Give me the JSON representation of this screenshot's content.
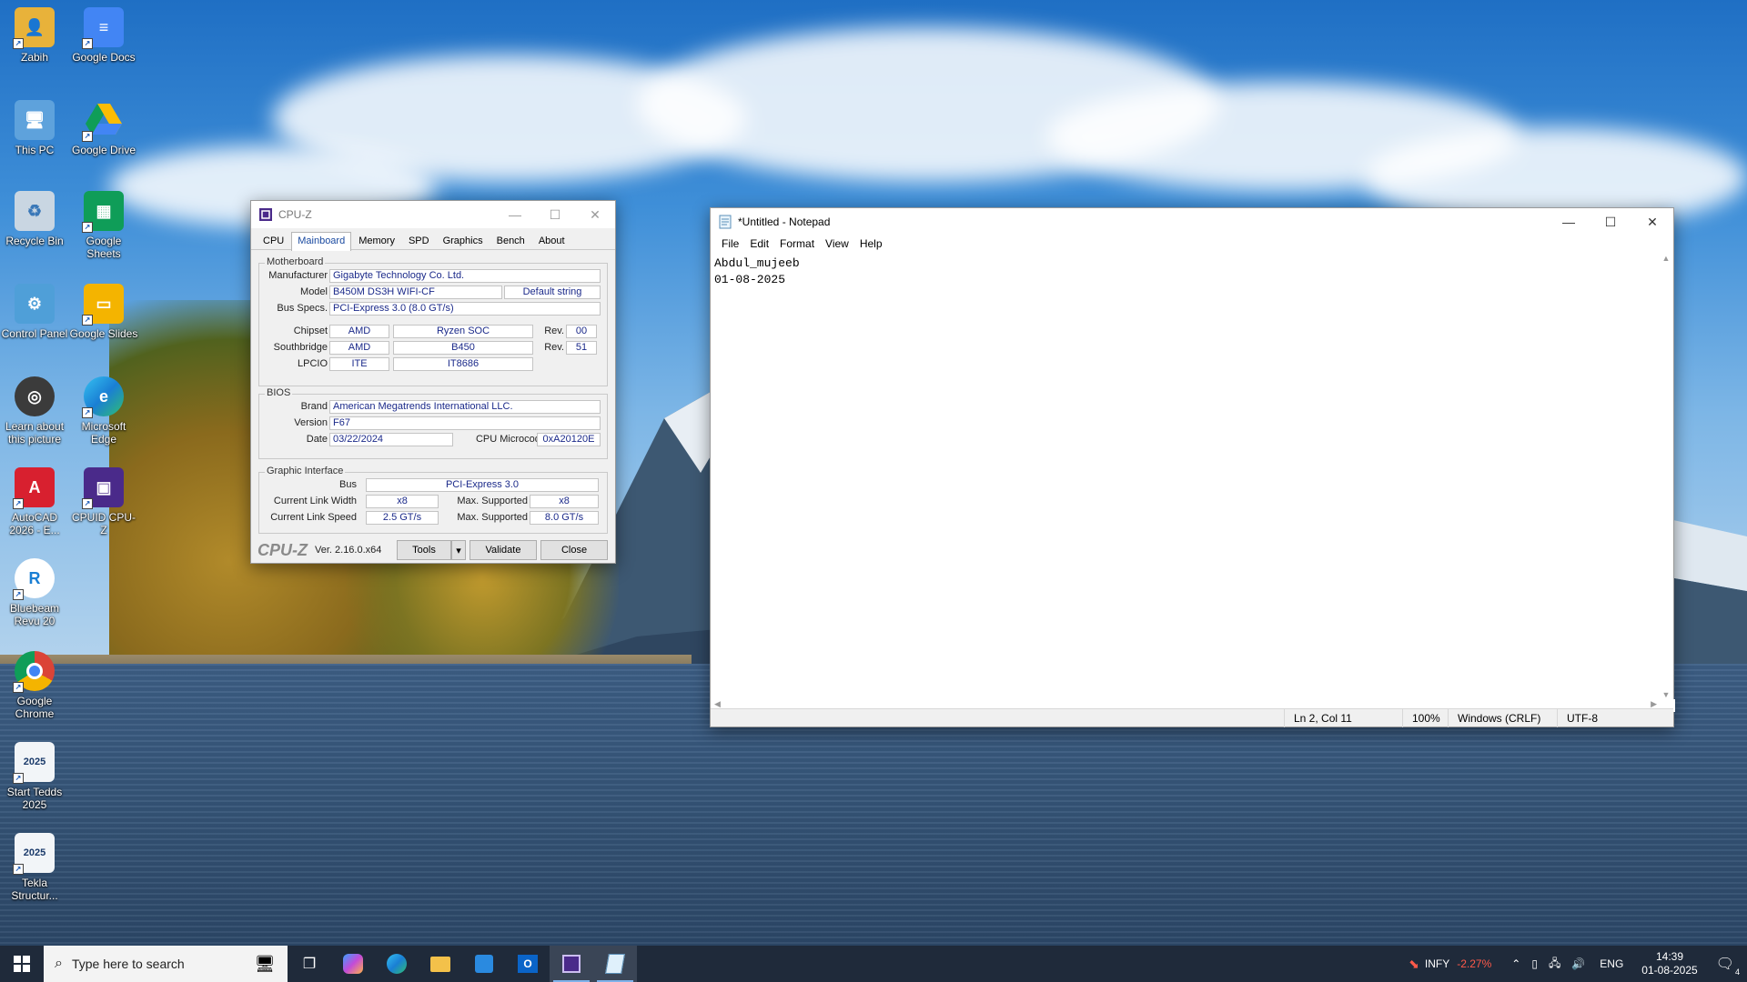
{
  "desktop": {
    "icons": [
      {
        "label": "Zabih",
        "icon": "user-folder-icon"
      },
      {
        "label": "Google Docs",
        "icon": "google-docs-icon"
      },
      {
        "label": "This PC",
        "icon": "this-pc-icon"
      },
      {
        "label": "Google Drive",
        "icon": "google-drive-icon"
      },
      {
        "label": "Recycle Bin",
        "icon": "recycle-bin-icon"
      },
      {
        "label": "Google Sheets",
        "icon": "google-sheets-icon"
      },
      {
        "label": "Control Panel",
        "icon": "control-panel-icon"
      },
      {
        "label": "Google Slides",
        "icon": "google-slides-icon"
      },
      {
        "label": "Learn about this picture",
        "icon": "learn-picture-icon"
      },
      {
        "label": "Microsoft Edge",
        "icon": "edge-icon"
      },
      {
        "label": "AutoCAD 2026 - E...",
        "icon": "autocad-icon"
      },
      {
        "label": "CPUID CPU-Z",
        "icon": "cpuz-icon"
      },
      {
        "label": "Bluebeam Revu 20",
        "icon": "bluebeam-icon"
      },
      {
        "label": "Google Chrome",
        "icon": "chrome-icon"
      },
      {
        "label": "Start Tedds 2025",
        "icon": "tedds-icon"
      },
      {
        "label": "Tekla Structur...",
        "icon": "tekla-icon"
      }
    ]
  },
  "cpuz": {
    "title": "CPU-Z",
    "tabs": [
      "CPU",
      "Mainboard",
      "Memory",
      "SPD",
      "Graphics",
      "Bench",
      "About"
    ],
    "active_tab": "Mainboard",
    "motherboard": {
      "group_title": "Motherboard",
      "manufacturer_label": "Manufacturer",
      "manufacturer": "Gigabyte Technology Co. Ltd.",
      "model_label": "Model",
      "model": "B450M DS3H WIFI-CF",
      "model_extra": "Default string",
      "bus_specs_label": "Bus Specs.",
      "bus_specs": "PCI-Express 3.0 (8.0 GT/s)",
      "chipset_label": "Chipset",
      "chipset_vendor": "AMD",
      "chipset_name": "Ryzen SOC",
      "chipset_rev_label": "Rev.",
      "chipset_rev": "00",
      "southbridge_label": "Southbridge",
      "southbridge_vendor": "AMD",
      "southbridge_name": "B450",
      "southbridge_rev_label": "Rev.",
      "southbridge_rev": "51",
      "lpcio_label": "LPCIO",
      "lpcio_vendor": "ITE",
      "lpcio_name": "IT8686"
    },
    "bios": {
      "group_title": "BIOS",
      "brand_label": "Brand",
      "brand": "American Megatrends International LLC.",
      "version_label": "Version",
      "version": "F67",
      "date_label": "Date",
      "date": "03/22/2024",
      "microcode_label": "CPU Microcode",
      "microcode": "0xA20120E"
    },
    "graphic": {
      "group_title": "Graphic Interface",
      "bus_label": "Bus",
      "bus": "PCI-Express 3.0",
      "link_width_label": "Current Link Width",
      "link_width": "x8",
      "max_width_label": "Max. Supported",
      "max_width": "x8",
      "link_speed_label": "Current Link Speed",
      "link_speed": "2.5 GT/s",
      "max_speed_label": "Max. Supported",
      "max_speed": "8.0 GT/s"
    },
    "footer": {
      "logo": "CPU-Z",
      "version": "Ver. 2.16.0.x64",
      "tools": "Tools",
      "validate": "Validate",
      "close": "Close"
    }
  },
  "notepad": {
    "title": "*Untitled - Notepad",
    "menu": [
      "File",
      "Edit",
      "Format",
      "View",
      "Help"
    ],
    "lines": [
      "Abdul_mujeeb",
      "01-08-2025"
    ],
    "status": {
      "position": "Ln 2, Col 11",
      "zoom": "100%",
      "line_ending": "Windows (CRLF)",
      "encoding": "UTF-8"
    }
  },
  "taskbar": {
    "search_placeholder": "Type here to search",
    "stock_name": "INFY",
    "stock_change": "-2.27%",
    "stock_color": "#ff5a4a",
    "language": "ENG",
    "time": "14:39",
    "date": "01-08-2025",
    "notification_count": "4"
  }
}
